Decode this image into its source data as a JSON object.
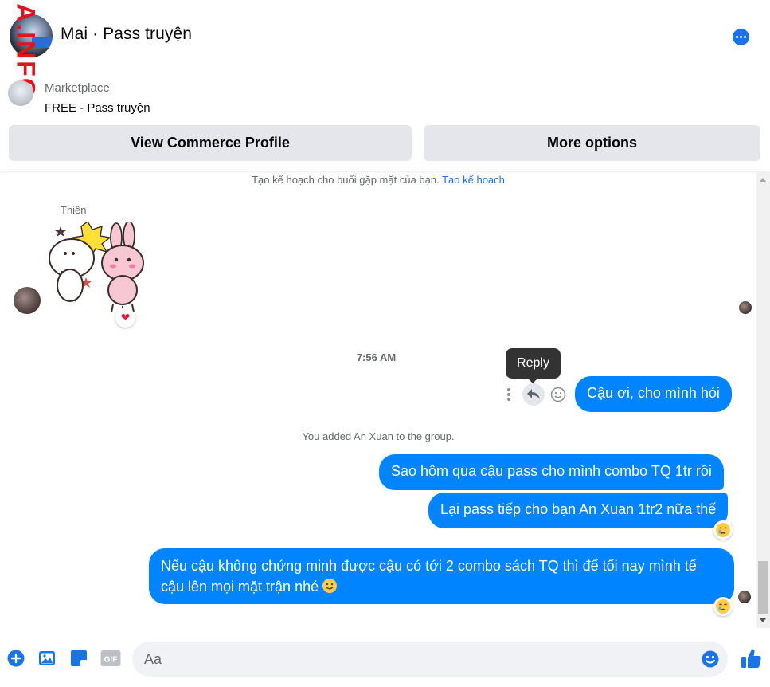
{
  "header": {
    "title": "Mai · Pass truyện",
    "watermark": "A.INFO",
    "marketplace_label": "Marketplace",
    "item_title": "FREE - Pass truyện",
    "view_profile_label": "View Commerce Profile",
    "more_options_label": "More options"
  },
  "messages": {
    "plan_text": "Tạo kế hoạch cho buổi gặp mặt của bạn.",
    "plan_link": "Tạo kế hoạch",
    "sender_name": "Thiên",
    "sticker_reaction": "❤",
    "timestamp": "7:56 AM",
    "tooltip": "Reply",
    "msg1": "Cậu ơi, cho mình hỏi",
    "system_added": "You added An Xuan to the group.",
    "msg2": "Sao hôm qua cậu pass cho mình combo TQ 1tr rồi",
    "msg3": "Lại pass tiếp cho bạn An Xuan 1tr2 nữa thế",
    "msg4": "Nếu cậu không chứng minh được cậu có tới 2 combo sách TQ thì để tối nay mình tế cậu lên mọi mặt trận nhé"
  },
  "composer": {
    "placeholder": "Aa",
    "gif_label": "GIF"
  },
  "icons": {
    "more": "more-dots-icon",
    "reply": "reply-arrow-icon",
    "react": "smiley-icon",
    "add": "plus-circle-icon",
    "photo": "photo-icon",
    "sticker": "sticker-icon",
    "gif": "gif-icon",
    "emoji": "emoji-icon",
    "like": "thumbs-up-icon"
  },
  "colors": {
    "accent": "#0084ff",
    "link": "#216fdb",
    "tooltip_bg": "#333333",
    "button_bg": "#e4e6eb"
  }
}
